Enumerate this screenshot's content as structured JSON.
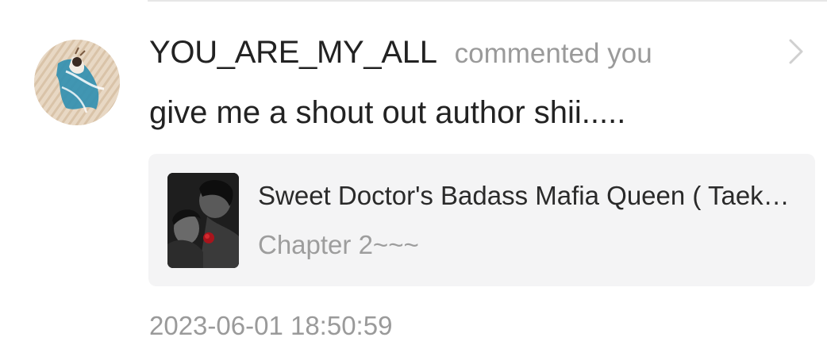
{
  "notification": {
    "username": "YOU_ARE_MY_ALL",
    "action": "commented you",
    "comment": "give me a shout out author shii.....",
    "timestamp": "2023-06-01 18:50:59",
    "icons": {
      "avatar": "user-avatar",
      "chevron": "chevron-right-icon",
      "cover": "book-cover"
    },
    "book": {
      "title": "Sweet Doctor's Badass Mafia Queen ( Taekook )",
      "chapter": "Chapter 2~~~"
    }
  },
  "colors": {
    "text_primary": "#222222",
    "text_secondary": "#9a9a9a",
    "card_background": "#f4f4f5",
    "divider": "#e6e6e6",
    "chevron": "#d0d0d0"
  }
}
